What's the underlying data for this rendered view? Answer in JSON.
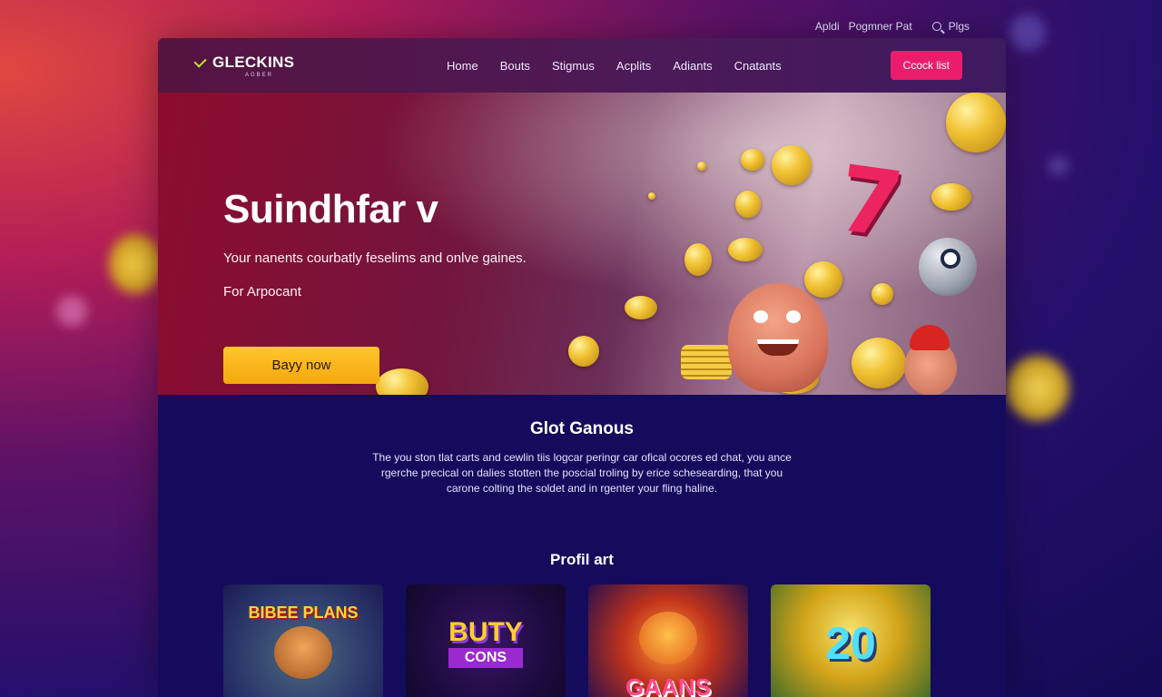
{
  "utility": {
    "link1": "Apldi",
    "link2": "Pogmner Pat",
    "search_label": "Plgs"
  },
  "brand": {
    "name": "GLECKINS",
    "tagline": "AGBER"
  },
  "nav": {
    "items": [
      "Home",
      "Bouts",
      "Stigmus",
      "Acplits",
      "Adiants",
      "Cnatants"
    ],
    "cta_label": "Ccock list"
  },
  "hero": {
    "title": "Suindhfar v",
    "subtitle": "Your nanents courbatly feselims and onlve gaines.",
    "note": "For Arpocant",
    "button_label": "Bayy now",
    "seven": "7"
  },
  "info": {
    "title": "Glot Ganous",
    "body": "The you ston tlat carts and cewlin tiis logcar peringr car ofical ocores ed chat, you ance rgerche precical on dalies stotten the poscial troling by erice schesearding, that you carone colting the soldet and in rgenter your fling haline."
  },
  "profile": {
    "title": "Profil art"
  },
  "tiles": [
    {
      "label": "BIBEE PLANS"
    },
    {
      "label": "BUTY",
      "sub": "CONS"
    },
    {
      "label": "GAANS"
    },
    {
      "label": "20"
    }
  ],
  "colors": {
    "accent_pink": "#ea1d6c",
    "hero_button": "#f4a80d",
    "card_bg": "#150b5c"
  },
  "icons": {
    "search": "search-icon",
    "logo_check": "check-icon"
  }
}
